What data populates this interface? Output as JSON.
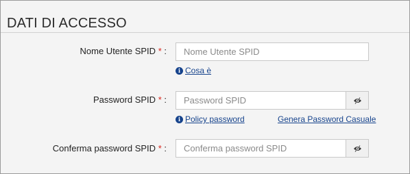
{
  "section": {
    "title": "DATI DI ACCESSO"
  },
  "username": {
    "label": "Nome Utente SPID",
    "required_mark": "*",
    "suffix": ":",
    "placeholder": "Nome Utente SPID",
    "value": "",
    "help_link": "Cosa è"
  },
  "password": {
    "label": "Password SPID",
    "required_mark": "*",
    "suffix": ":",
    "placeholder": "Password SPID",
    "value": "",
    "policy_link": "Policy password",
    "generate_link": "Genera Password Casuale",
    "toggle_icon": "eye-slash-icon"
  },
  "confirm": {
    "label": "Conferma password SPID",
    "required_mark": "*",
    "suffix": ":",
    "placeholder": "Conferma password SPID",
    "value": "",
    "toggle_icon": "eye-slash-icon"
  },
  "colors": {
    "link": "#16438c",
    "required": "#d9251c",
    "panel_bg": "#f4f4f4"
  }
}
